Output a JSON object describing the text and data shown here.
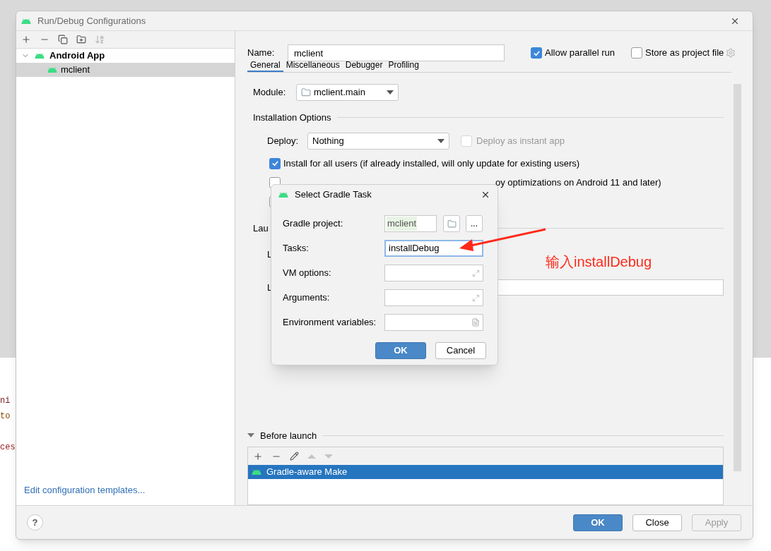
{
  "background_code": [
    {
      "text": "ni",
      "color": "#7a1f1f"
    },
    {
      "text": "to",
      "color": "#8a4a00"
    },
    {
      "text": "ces",
      "color": "#a02020"
    }
  ],
  "window": {
    "title": "Run/Debug Configurations"
  },
  "sidebar": {
    "items": [
      {
        "label": "Android App",
        "selected": false,
        "expanded": true,
        "children": [
          {
            "label": "mclient",
            "selected": true
          }
        ]
      }
    ],
    "link": "Edit configuration templates..."
  },
  "name_field": {
    "label": "Name:",
    "value": "mclient"
  },
  "options": [
    {
      "label": "Allow parallel run",
      "checked": true
    },
    {
      "label": "Store as project file",
      "checked": false
    }
  ],
  "tabs": [
    {
      "label": "General",
      "selected": true
    },
    {
      "label": "Miscellaneous",
      "selected": false
    },
    {
      "label": "Debugger",
      "selected": false
    },
    {
      "label": "Profiling",
      "selected": false
    }
  ],
  "module": {
    "label": "Module:",
    "value": "mclient.main"
  },
  "installation": {
    "heading": "Installation Options",
    "deploy_label": "Deploy:",
    "deploy_value": "Nothing",
    "instant_app": {
      "label": "Deploy as instant app",
      "checked": false,
      "disabled": true
    },
    "checks": [
      {
        "label": "Install for all users (if already installed, will only update for existing users)",
        "checked": true
      },
      {
        "label": "oy optimizations on Android 11 and later)",
        "checked": false
      },
      {
        "checked": false
      }
    ]
  },
  "launch": {
    "heading": "Lau",
    "rows": [
      "L",
      "L"
    ]
  },
  "annotation": {
    "text": "输入installDebug",
    "color": "#ff2a1a"
  },
  "before_launch": {
    "heading": "Before launch",
    "expanded": true,
    "items": [
      {
        "label": "Gradle-aware Make",
        "selected": true
      }
    ]
  },
  "help_button": "?",
  "buttons": [
    {
      "label": "OK",
      "kind": "primary"
    },
    {
      "label": "Close",
      "kind": "normal"
    },
    {
      "label": "Apply",
      "kind": "disabled"
    }
  ],
  "gradle_dialog": {
    "title": "Select Gradle Task",
    "project_label": "Gradle project:",
    "project_value": "mclient",
    "more": "...",
    "fields": [
      {
        "label": "Tasks:",
        "value": "installDebug",
        "kind": "text",
        "focused": true
      },
      {
        "label": "VM options:",
        "kind": "expand",
        "focused": false
      },
      {
        "label": "Arguments:",
        "kind": "expand",
        "focused": false
      },
      {
        "label": "Environment variables:",
        "kind": "doc",
        "focused": false
      }
    ],
    "buttons": [
      {
        "label": "OK",
        "kind": "primary"
      },
      {
        "label": "Cancel",
        "kind": "normal"
      }
    ]
  }
}
